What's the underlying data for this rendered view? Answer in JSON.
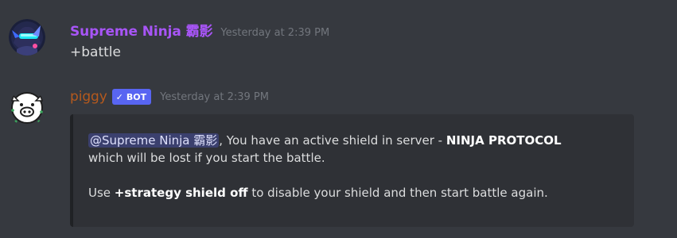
{
  "messages": [
    {
      "author": "Supreme Ninja 霸影",
      "author_color": "#a855f7",
      "avatar_icon": "ninja-avatar-icon",
      "timestamp": "Yesterday at 2:39 PM",
      "content": "+battle"
    },
    {
      "author": "piggy",
      "author_color": "#b5591d",
      "avatar_icon": "pig-avatar-icon",
      "badge": {
        "check": "✓",
        "label": "BOT",
        "color": "#5865f2"
      },
      "timestamp": "Yesterday at 2:39 PM",
      "embed": {
        "mention": "@Supreme Ninja 霸影",
        "line1_text": ", You have an active shield in server - ",
        "server_name": "NINJA PROTOCOL",
        "line2_text": "which will be lost if you start the battle.",
        "line3_prefix": "Use ",
        "command": "+strategy shield off",
        "line3_suffix": " to disable your shield and then start battle again."
      }
    }
  ]
}
